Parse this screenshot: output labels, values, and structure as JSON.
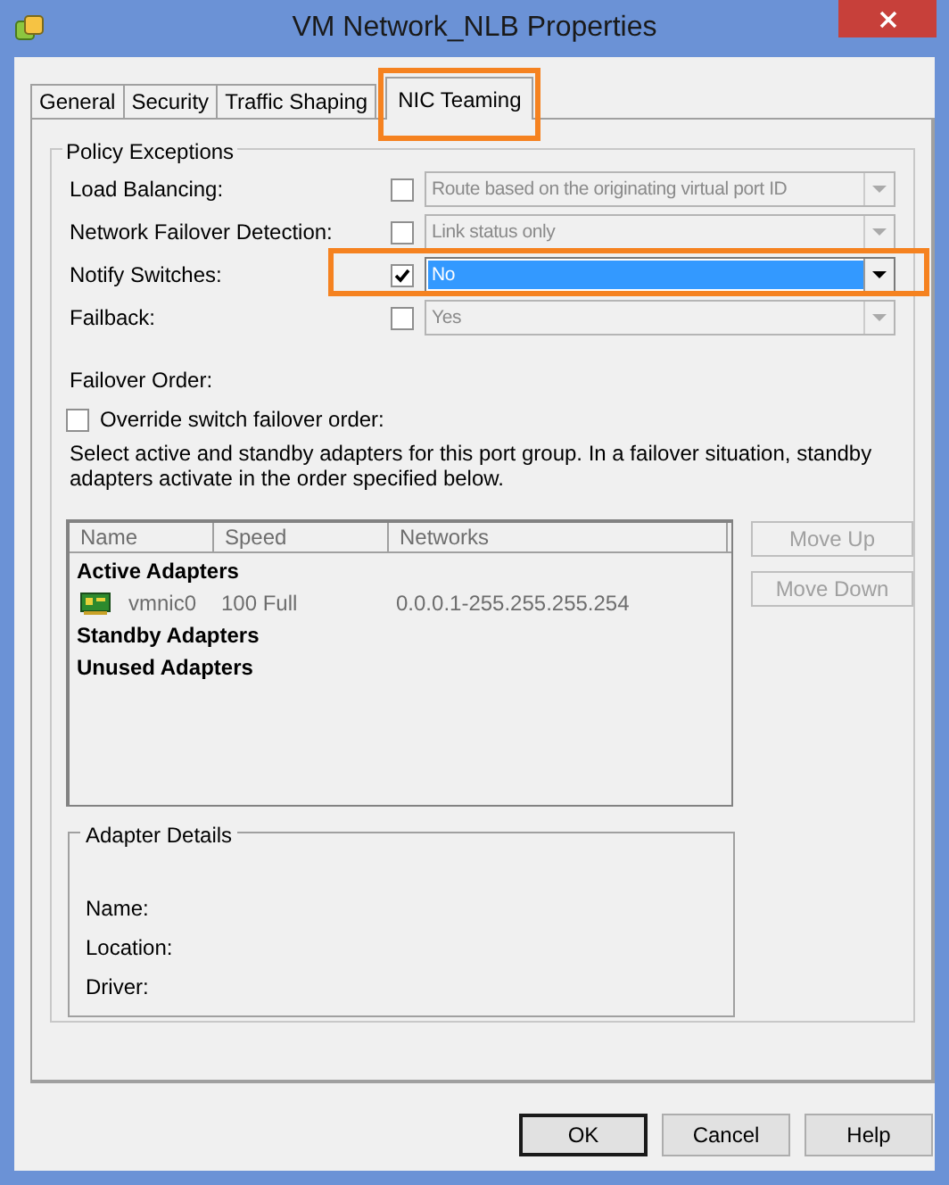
{
  "window": {
    "title": "VM Network_NLB Properties"
  },
  "tabs": [
    {
      "label": "General",
      "selected": false,
      "highlighted": false
    },
    {
      "label": "Security",
      "selected": false,
      "highlighted": false
    },
    {
      "label": "Traffic Shaping",
      "selected": false,
      "highlighted": false
    },
    {
      "label": "NIC Teaming",
      "selected": true,
      "highlighted": true
    }
  ],
  "policy_exceptions": {
    "title": "Policy Exceptions",
    "rows": [
      {
        "label": "Load Balancing:",
        "checked": false,
        "value": "Route based on the originating virtual port ID",
        "highlighted": false
      },
      {
        "label": "Network Failover Detection:",
        "checked": false,
        "value": "Link status only",
        "highlighted": false
      },
      {
        "label": "Notify Switches:",
        "checked": true,
        "value": "No",
        "highlighted": true
      },
      {
        "label": "Failback:",
        "checked": false,
        "value": "Yes",
        "highlighted": false
      }
    ],
    "failover_order": {
      "label": "Failover Order:",
      "override": {
        "label": "Override switch failover order:",
        "checked": false
      },
      "description": "Select active and standby adapters for this port group.  In a failover situation, standby adapters activate  in the order specified below.",
      "columns": [
        "Name",
        "Speed",
        "Networks"
      ],
      "groups": [
        {
          "label": "Active Adapters",
          "adapters": [
            {
              "name": "vmnic0",
              "speed": "100 Full",
              "networks": "0.0.0.1-255.255.255.254"
            }
          ]
        },
        {
          "label": "Standby Adapters"
        },
        {
          "label": "Unused Adapters"
        }
      ],
      "buttons": [
        {
          "label": "Move Up",
          "disabled": true
        },
        {
          "label": "Move Down",
          "disabled": true
        }
      ],
      "adapter_details": {
        "title": "Adapter Details",
        "fields": [
          "Name:",
          "Location:",
          "Driver:"
        ]
      }
    }
  },
  "buttons": [
    {
      "label": "OK",
      "default": true
    },
    {
      "label": "Cancel",
      "default": false
    },
    {
      "label": "Help",
      "default": false
    }
  ]
}
